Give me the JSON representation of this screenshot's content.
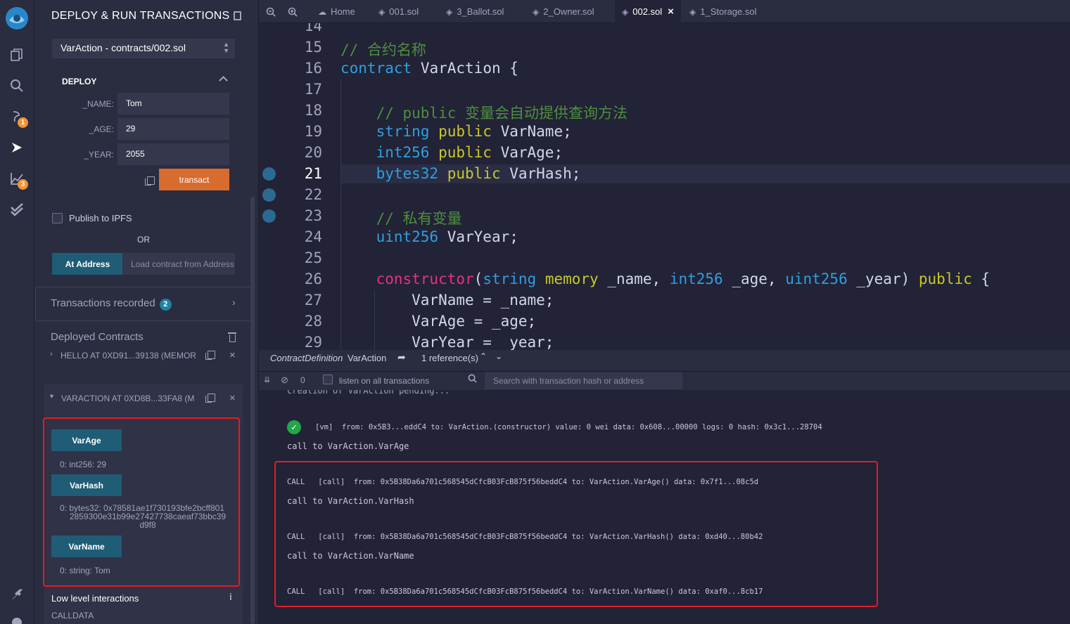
{
  "panel": {
    "title": "DEPLOY & RUN TRANSACTIONS",
    "contract_select": "VarAction - contracts/002.sol",
    "deploy_label": "DEPLOY",
    "params": [
      {
        "label": "_NAME:",
        "value": "Tom"
      },
      {
        "label": "_AGE:",
        "value": "29"
      },
      {
        "label": "_YEAR:",
        "value": "2055"
      }
    ],
    "transact_label": "transact",
    "publish_ipfs": "Publish to IPFS",
    "or_label": "OR",
    "at_address_label": "At Address",
    "load_contract_placeholder": "Load contract from Address",
    "transactions_recorded": "Transactions recorded",
    "transactions_count": "2",
    "deployed_contracts": "Deployed Contracts",
    "hello_instance": "HELLO AT 0XD91...39138 (MEMOR",
    "varaction_instance": "VARACTION AT 0XD8B...33FA8 (M",
    "functions": [
      {
        "name": "VarAge",
        "result": "0: int256: 29"
      },
      {
        "name": "VarHash",
        "result_lines": [
          "0: bytes32: 0x78581ae1f730193bfe2bcff801",
          "2859300e31b99e27427738caeaf73bbc39",
          "d9f8"
        ]
      },
      {
        "name": "VarName",
        "result": "0: string: Tom"
      }
    ],
    "low_level": "Low level interactions",
    "calldata": "CALLDATA"
  },
  "tabs": [
    {
      "label": "Home",
      "icon": "remix-home-icon"
    },
    {
      "label": "001.sol",
      "icon": "solidity-icon"
    },
    {
      "label": "3_Ballot.sol",
      "icon": "solidity-icon"
    },
    {
      "label": "2_Owner.sol",
      "icon": "solidity-icon"
    },
    {
      "label": "002.sol",
      "icon": "solidity-icon",
      "active": true
    },
    {
      "label": "1_Storage.sol",
      "icon": "solidity-icon"
    }
  ],
  "editor": {
    "line_numbers": [
      "14",
      "15",
      "16",
      "17",
      "18",
      "19",
      "20",
      "21",
      "22",
      "23",
      "24",
      "25",
      "26",
      "27",
      "28",
      "29"
    ],
    "current_line": "21"
  },
  "refbar": {
    "definition": "ContractDefinition",
    "name": "VarAction",
    "references": "1 reference(s)"
  },
  "terminal": {
    "count": "0",
    "listen_label": "listen on all transactions",
    "search_placeholder": "Search with transaction hash or address",
    "cut_line": "creation of VarAction pending...",
    "vm_line": "[vm]  from: 0x5B3...eddC4 to: VarAction.(constructor) value: 0 wei data: 0x608...00000 logs: 0 hash: 0x3c1...28704",
    "call_varage": "call to VarAction.VarAge",
    "call1": "CALL   [call]  from: 0x5B38Da6a701c568545dCfcB03FcB875f56beddC4 to: VarAction.VarAge() data: 0x7f1...08c5d",
    "call_varhash": "call to VarAction.VarHash",
    "call2": "CALL   [call]  from: 0x5B38Da6a701c568545dCfcB03FcB875f56beddC4 to: VarAction.VarHash() data: 0xd40...80b42",
    "call_varname": "call to VarAction.VarName",
    "call3": "CALL   [call]  from: 0x5B38Da6a701c568545dCfcB03FcB875f56beddC4 to: VarAction.VarName() data: 0xaf0...8cb17"
  },
  "rail_badges": {
    "plugin": "1",
    "analysis": "3"
  },
  "colors": {
    "accent_orange": "#d86c2f",
    "button_blue": "#1f5c76",
    "highlight_red": "#e11d25",
    "background": "#222336"
  }
}
